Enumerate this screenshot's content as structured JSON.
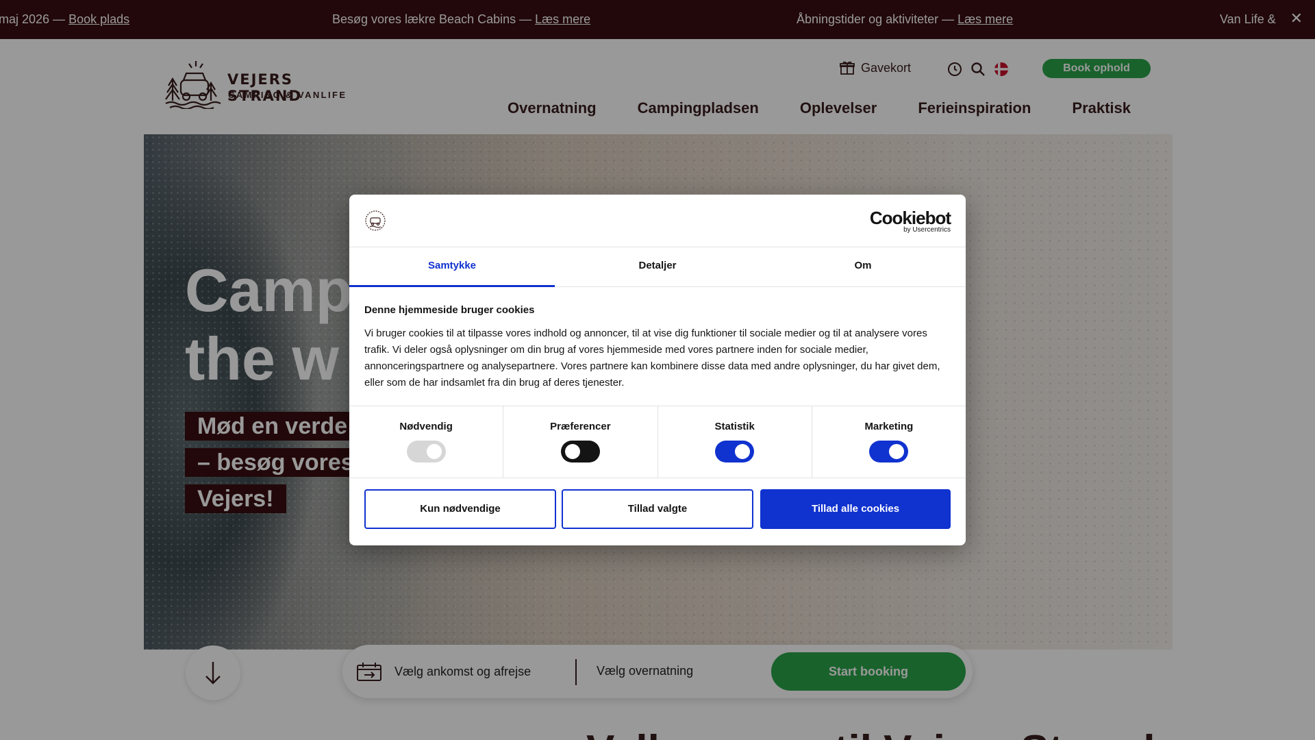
{
  "topbar": {
    "items": [
      {
        "text": "maj 2026 — ",
        "link": "Book plads"
      },
      {
        "text": "Besøg vores lækre Beach Cabins — ",
        "link": "Læs mere"
      },
      {
        "text": "Åbningstider og aktiviteter — ",
        "link": "Læs mere"
      },
      {
        "text": "Van Life &",
        "link": ""
      }
    ],
    "close_icon": "close-icon"
  },
  "header": {
    "logo_title": "VEJERS STRAND",
    "logo_subtitle": "CAMPING & VANLIFE",
    "giftcard_label": "Gavekort",
    "book_button": "Book ophold",
    "nav": [
      "Overnatning",
      "Campingpladsen",
      "Oplevelser",
      "Ferieinspiration",
      "Praktisk"
    ]
  },
  "hero": {
    "title_line1": "Camp",
    "title_line2": "the w",
    "subtitle_lines": [
      "Mød en verde",
      "– besøg vores",
      "Vejers!"
    ]
  },
  "booking": {
    "dates_label": "Vælg ankomst og afrejse",
    "lodging_label": "Vælg overnatning",
    "start_button": "Start booking"
  },
  "below": {
    "heading": "Velkommen til Vejers Strand"
  },
  "cookie_dialog": {
    "brand": "Cookiebot",
    "brand_sub": "by Usercentrics",
    "tabs": [
      "Samtykke",
      "Detaljer",
      "Om"
    ],
    "active_tab": "Samtykke",
    "heading": "Denne hjemmeside bruger cookies",
    "body": "Vi bruger cookies til at tilpasse vores indhold og annoncer, til at vise dig funktioner til sociale medier og til at analysere vores trafik. Vi deler også oplysninger om din brug af vores hjemmeside med vores partnere inden for sociale medier, annonceringspartnere og analysepartnere. Vores partnere kan kombinere disse data med andre oplysninger, du har givet dem, eller som de har indsamlet fra din brug af deres tjenester.",
    "toggles": [
      {
        "label": "Nødvendig",
        "state": "on",
        "disabled": true
      },
      {
        "label": "Præferencer",
        "state": "off",
        "disabled": false
      },
      {
        "label": "Statistik",
        "state": "on",
        "disabled": false
      },
      {
        "label": "Marketing",
        "state": "on",
        "disabled": false
      }
    ],
    "buttons": {
      "necessary_only": "Kun nødvendige",
      "allow_selected": "Tillad valgte",
      "allow_all": "Tillad alle cookies"
    }
  },
  "colors": {
    "maroon": "#3a0e12",
    "green": "#2aa34a",
    "cookie_blue": "#1032cf",
    "toggle_off": "#141414",
    "toggle_disabled": "#d6d6d6",
    "text_dark": "#3a1d1d"
  }
}
